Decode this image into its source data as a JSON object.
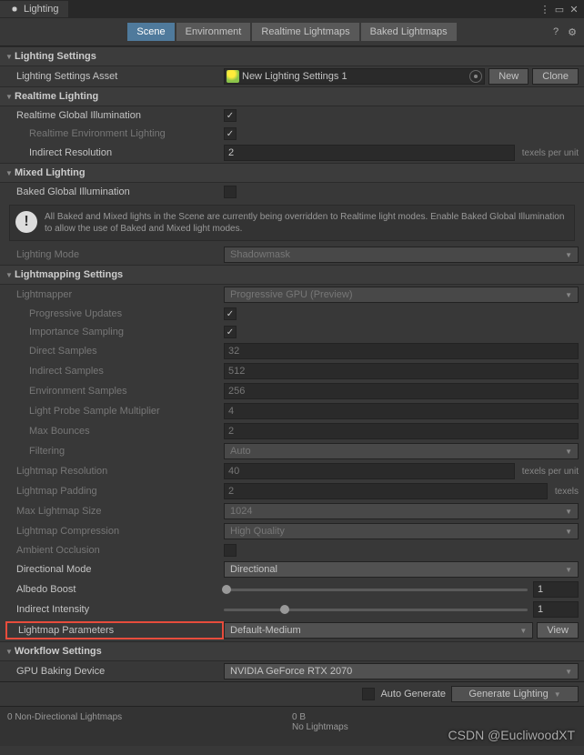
{
  "window": {
    "title": "Lighting"
  },
  "tabs": {
    "scene": "Scene",
    "environment": "Environment",
    "realtime": "Realtime Lightmaps",
    "baked": "Baked Lightmaps"
  },
  "sections": {
    "lighting_settings": "Lighting Settings",
    "realtime_lighting": "Realtime Lighting",
    "mixed_lighting": "Mixed Lighting",
    "lightmapping_settings": "Lightmapping Settings",
    "workflow_settings": "Workflow Settings"
  },
  "fields": {
    "asset_label": "Lighting Settings Asset",
    "asset_value": "New Lighting Settings 1",
    "new_btn": "New",
    "clone_btn": "Clone",
    "realtime_gi": "Realtime Global Illumination",
    "realtime_env": "Realtime Environment Lighting",
    "indirect_res": "Indirect Resolution",
    "indirect_res_val": "2",
    "texels_unit": "texels per unit",
    "baked_gi": "Baked Global Illumination",
    "info": "All Baked and Mixed lights in the Scene are currently being overridden to Realtime light modes. Enable Baked Global Illumination to allow the use of Baked and Mixed light modes.",
    "lighting_mode": "Lighting Mode",
    "lighting_mode_val": "Shadowmask",
    "lightmapper": "Lightmapper",
    "lightmapper_val": "Progressive GPU (Preview)",
    "prog_updates": "Progressive Updates",
    "imp_sampling": "Importance Sampling",
    "direct_samples": "Direct Samples",
    "direct_samples_val": "32",
    "indirect_samples": "Indirect Samples",
    "indirect_samples_val": "512",
    "env_samples": "Environment Samples",
    "env_samples_val": "256",
    "light_probe_mult": "Light Probe Sample Multiplier",
    "light_probe_mult_val": "4",
    "max_bounces": "Max Bounces",
    "max_bounces_val": "2",
    "filtering": "Filtering",
    "filtering_val": "Auto",
    "lightmap_res": "Lightmap Resolution",
    "lightmap_res_val": "40",
    "lightmap_padding": "Lightmap Padding",
    "lightmap_padding_val": "2",
    "texels": "texels",
    "max_lm_size": "Max Lightmap Size",
    "max_lm_size_val": "1024",
    "lm_compression": "Lightmap Compression",
    "lm_compression_val": "High Quality",
    "ambient_occ": "Ambient Occlusion",
    "dir_mode": "Directional Mode",
    "dir_mode_val": "Directional",
    "albedo_boost": "Albedo Boost",
    "albedo_boost_val": "1",
    "indirect_intensity": "Indirect Intensity",
    "indirect_intensity_val": "1",
    "lm_params": "Lightmap Parameters",
    "lm_params_val": "Default-Medium",
    "view_btn": "View",
    "gpu_device": "GPU Baking Device",
    "gpu_device_val": "NVIDIA GeForce RTX 2070",
    "auto_gen": "Auto Generate",
    "gen_lighting": "Generate Lighting"
  },
  "footer": {
    "lightmaps": "0 Non-Directional Lightmaps",
    "size": "0 B",
    "status": "No Lightmaps",
    "watermark": "CSDN @EucliwoodXT"
  }
}
